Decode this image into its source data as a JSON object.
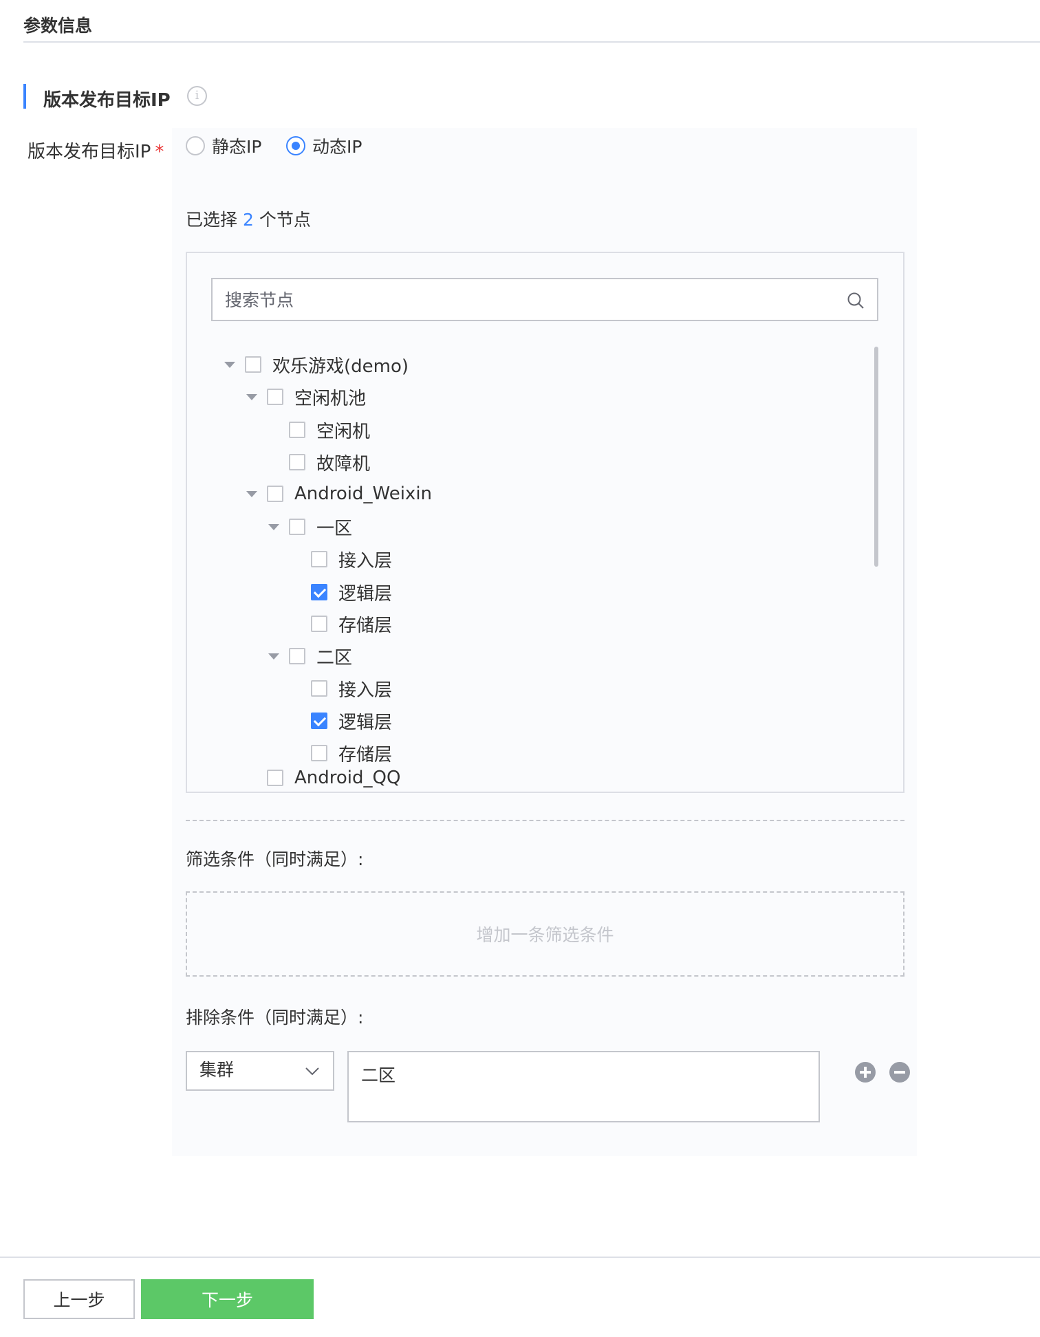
{
  "page": {
    "title": "参数信息"
  },
  "section": {
    "title": "版本发布目标IP",
    "info_icon": "info-icon"
  },
  "form": {
    "label": "版本发布目标IP",
    "required_mark": "*"
  },
  "ip_type": {
    "options": [
      {
        "label": "静态IP",
        "selected": false
      },
      {
        "label": "动态IP",
        "selected": true
      }
    ]
  },
  "selection": {
    "prefix": "已选择",
    "count": "2",
    "suffix": "个节点"
  },
  "search": {
    "placeholder": "搜索节点",
    "value": ""
  },
  "tree": {
    "nodes": [
      {
        "label": "欢乐游戏(demo)",
        "level": 0,
        "expanded": true,
        "checked": false
      },
      {
        "label": "空闲机池",
        "level": 1,
        "expanded": true,
        "checked": false
      },
      {
        "label": "空闲机",
        "level": 2,
        "checked": false
      },
      {
        "label": "故障机",
        "level": 2,
        "checked": false
      },
      {
        "label": "Android_Weixin",
        "level": 1,
        "expanded": true,
        "checked": false
      },
      {
        "label": "一区",
        "level": 2,
        "expanded": true,
        "checked": false
      },
      {
        "label": "接入层",
        "level": 3,
        "checked": false
      },
      {
        "label": "逻辑层",
        "level": 3,
        "checked": true
      },
      {
        "label": "存储层",
        "level": 3,
        "checked": false
      },
      {
        "label": "二区",
        "level": 2,
        "expanded": true,
        "checked": false
      },
      {
        "label": "接入层",
        "level": 3,
        "checked": false
      },
      {
        "label": "逻辑层",
        "level": 3,
        "checked": true
      },
      {
        "label": "存储层",
        "level": 3,
        "checked": false
      },
      {
        "label": "Android_QQ",
        "level": 1,
        "checked": false
      }
    ]
  },
  "filter": {
    "label": "筛选条件（同时满足）:",
    "add_text": "增加一条筛选条件"
  },
  "exclude": {
    "label": "排除条件（同时满足）:",
    "field": "集群",
    "value": "二区"
  },
  "footer": {
    "prev_label": "上一步",
    "next_label": "下一步"
  },
  "colors": {
    "accent": "#3a84ff",
    "primary_button": "#5cc867",
    "required": "#ea3636",
    "border": "#c4c6cc"
  }
}
